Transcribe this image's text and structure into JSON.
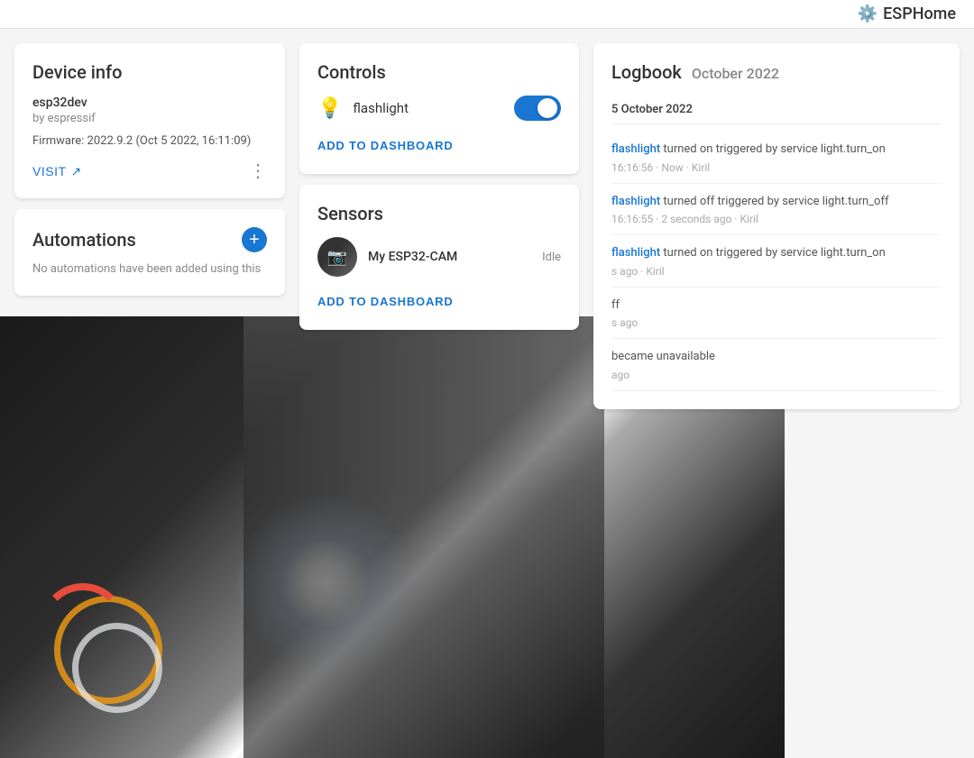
{
  "topbar": {
    "logo_text": "ESPHome",
    "logo_icon": "🏠"
  },
  "device_info": {
    "title": "Device info",
    "device_name": "esp32dev",
    "device_by": "by espressif",
    "firmware": "Firmware: 2022.9.2 (Oct 5 2022, 16:11:09)",
    "visit_label": "VISIT"
  },
  "automations": {
    "title": "Automations",
    "empty_text": "No automations have been added using this"
  },
  "controls": {
    "title": "Controls",
    "flashlight_label": "flashlight",
    "toggle_on": true,
    "add_to_dashboard_label": "ADD TO DASHBOARD"
  },
  "sensors": {
    "title": "Sensors",
    "items": [
      {
        "name": "My ESP32-CAM",
        "status": "Idle"
      }
    ],
    "add_to_dashboard_label": "ADD TO DASHBOARD"
  },
  "logbook": {
    "title": "Logbook",
    "month": "October 2022",
    "date_header": "5 October 2022",
    "entries": [
      {
        "entity": "flashlight",
        "action": "turned on triggered by service light.turn_on",
        "time": "16:16:56 · Now · Kiril"
      },
      {
        "entity": "flashlight",
        "action": "turned off triggered by service light.turn_off",
        "time": "16:16:55 · 2 seconds ago · Kiril"
      },
      {
        "entity": "flashlight",
        "action": "turned on triggered by service light.turn_on",
        "time": "s ago · Kiril"
      },
      {
        "entity": "",
        "action": "ff",
        "time": "s ago"
      },
      {
        "entity": "",
        "action": "became unavailable",
        "time": "ago"
      }
    ]
  }
}
